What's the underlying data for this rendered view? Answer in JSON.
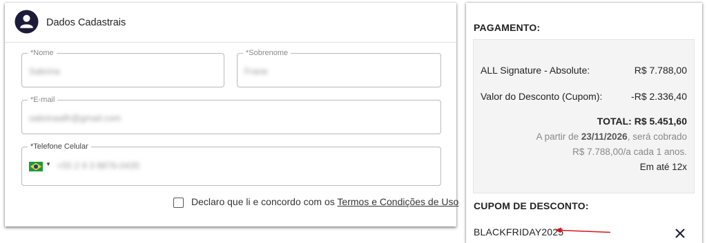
{
  "customer": {
    "title": "Dados Cadastrais",
    "first_name": {
      "label": "*Nome",
      "value": "Sabrina"
    },
    "last_name": {
      "label": "*Sobrenome",
      "value": "Frane"
    },
    "email": {
      "label": "*E-mail",
      "value": "sabrinaalfr@gmail.com"
    },
    "phone": {
      "label": "*Telefone Celular",
      "country_flag": "brazil-flag-icon",
      "value": "+55 2 9 3 8876-0435"
    },
    "consent": {
      "prefix": "Declaro que li e concordo com os ",
      "link": "Termos e Condições de Uso",
      "checked": false
    }
  },
  "payment": {
    "title": "PAGAMENTO:",
    "product_label": "ALL Signature - Absolute:",
    "product_price": "R$ 7.788,00",
    "discount_label": "Valor do Desconto (Cupom):",
    "discount_value": "-R$ 2.336,40",
    "total": "TOTAL: R$ 5.451,60",
    "renewal_prefix": "A partir de ",
    "renewal_date": "23/11/2026",
    "renewal_suffix": ", será cobrado",
    "renewal_amount": "R$ 7.788,00/a cada 1 anos.",
    "installments": "Em até 12x"
  },
  "coupon": {
    "title": "CUPOM DE DESCONTO:",
    "code": "BLACKFRIDAY2025",
    "remove_icon": "close-icon"
  },
  "colors": {
    "avatar": "#1c1c3a",
    "annotation_arrow": "#d3151b",
    "summary_bg": "#f4f4f4"
  }
}
